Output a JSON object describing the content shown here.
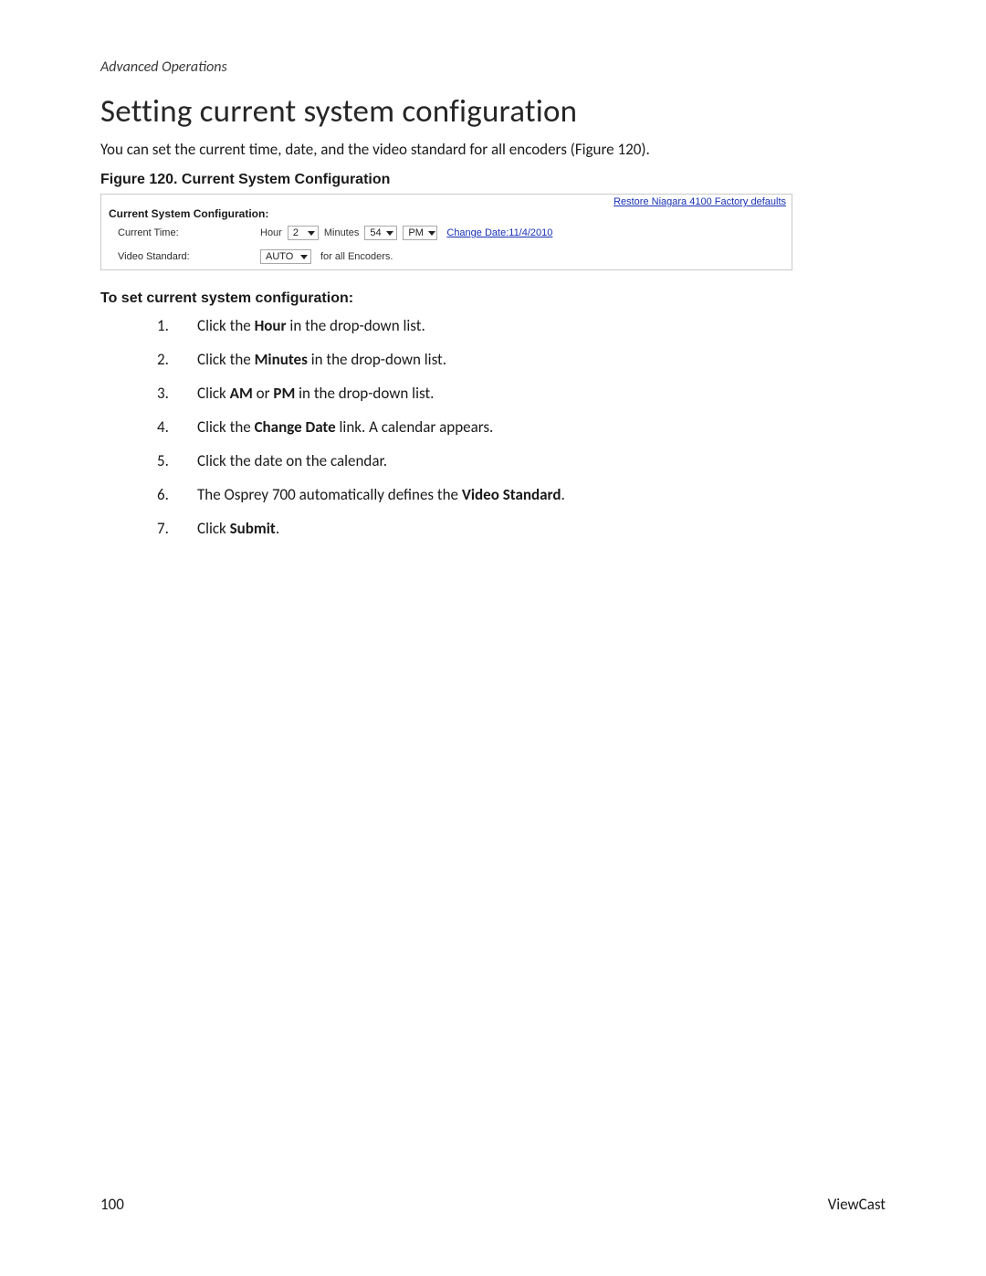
{
  "breadcrumb": "Advanced Operations",
  "title": "Setting current system configuration",
  "intro": "You can set the current time, date, and the video standard for all encoders (Figure 120).",
  "figcap": "Figure 120. Current System Configuration",
  "figure": {
    "restore_link": "Restore Niagara 4100 Factory defaults",
    "section_title": "Current System Configuration:",
    "row1": {
      "label": "Current Time:",
      "hour_prefix": "Hour",
      "hour_value": "2",
      "min_prefix": "Minutes",
      "min_value": "54",
      "ampm_value": "PM",
      "change_date_label": "Change Date:",
      "change_date_value": "11/4/2010"
    },
    "row2": {
      "label": "Video Standard:",
      "auto_value": "AUTO",
      "suffix": "for all Encoders."
    }
  },
  "subhead": "To set current system configuration:",
  "steps": [
    {
      "n": "1.",
      "pre": "Click the ",
      "b": "Hour",
      "post": " in the drop-down list."
    },
    {
      "n": "2.",
      "pre": "Click the ",
      "b": "Minutes",
      "post": " in the drop-down list."
    },
    {
      "n": "3.",
      "pre": "Click ",
      "b": "AM",
      "mid": " or ",
      "b2": "PM",
      "post": " in the drop-down list."
    },
    {
      "n": "4.",
      "pre": "Click the ",
      "b": "Change Date",
      "post": " link. A calendar appears."
    },
    {
      "n": "5.",
      "pre": "Click the date on the calendar.",
      "b": "",
      "post": ""
    },
    {
      "n": "6.",
      "pre": "The Osprey 700 automatically defines the ",
      "b": "Video Standard",
      "post": "."
    },
    {
      "n": "7.",
      "pre": "Click ",
      "b": "Submit",
      "post": "."
    }
  ],
  "footer": {
    "page": "100",
    "brand": "ViewCast"
  }
}
